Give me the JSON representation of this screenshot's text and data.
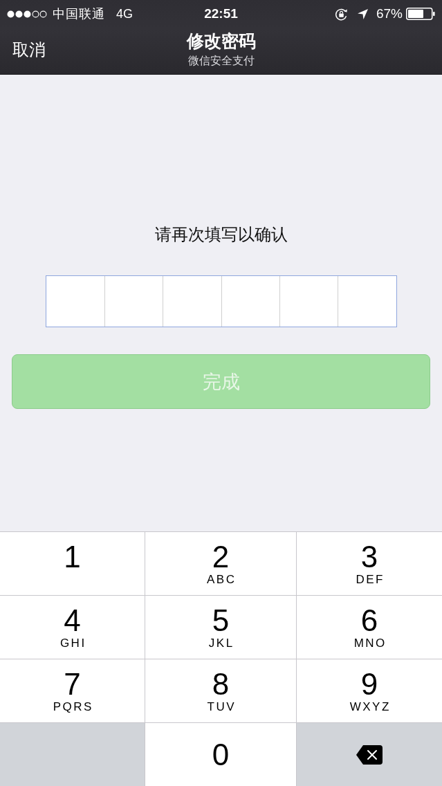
{
  "status_bar": {
    "carrier": "中国联通",
    "network": "4G",
    "time": "22:51",
    "battery": "67%"
  },
  "nav_bar": {
    "cancel": "取消",
    "title": "修改密码",
    "subtitle": "微信安全支付"
  },
  "prompt": "请再次填写以确认",
  "password_field": {
    "focused": true
  },
  "done_button": {
    "label": "完成",
    "disabled": true
  },
  "keypad": {
    "rows": [
      [
        {
          "kind": "digit",
          "digit": "1"
        },
        {
          "kind": "digit",
          "digit": "2",
          "letters": "ABC"
        },
        {
          "kind": "digit",
          "digit": "3",
          "letters": "DEF"
        }
      ],
      [
        {
          "kind": "digit",
          "digit": "4",
          "letters": "GHI"
        },
        {
          "kind": "digit",
          "digit": "5",
          "letters": "JKL"
        },
        {
          "kind": "digit",
          "digit": "6",
          "letters": "MNO"
        }
      ],
      [
        {
          "kind": "digit",
          "digit": "7",
          "letters": "PQRS"
        },
        {
          "kind": "digit",
          "digit": "8",
          "letters": "TUV"
        },
        {
          "kind": "digit",
          "digit": "9",
          "letters": "WXYZ"
        }
      ],
      [
        {
          "kind": "blank"
        },
        {
          "kind": "digit",
          "digit": "0"
        },
        {
          "kind": "delete"
        }
      ]
    ]
  }
}
